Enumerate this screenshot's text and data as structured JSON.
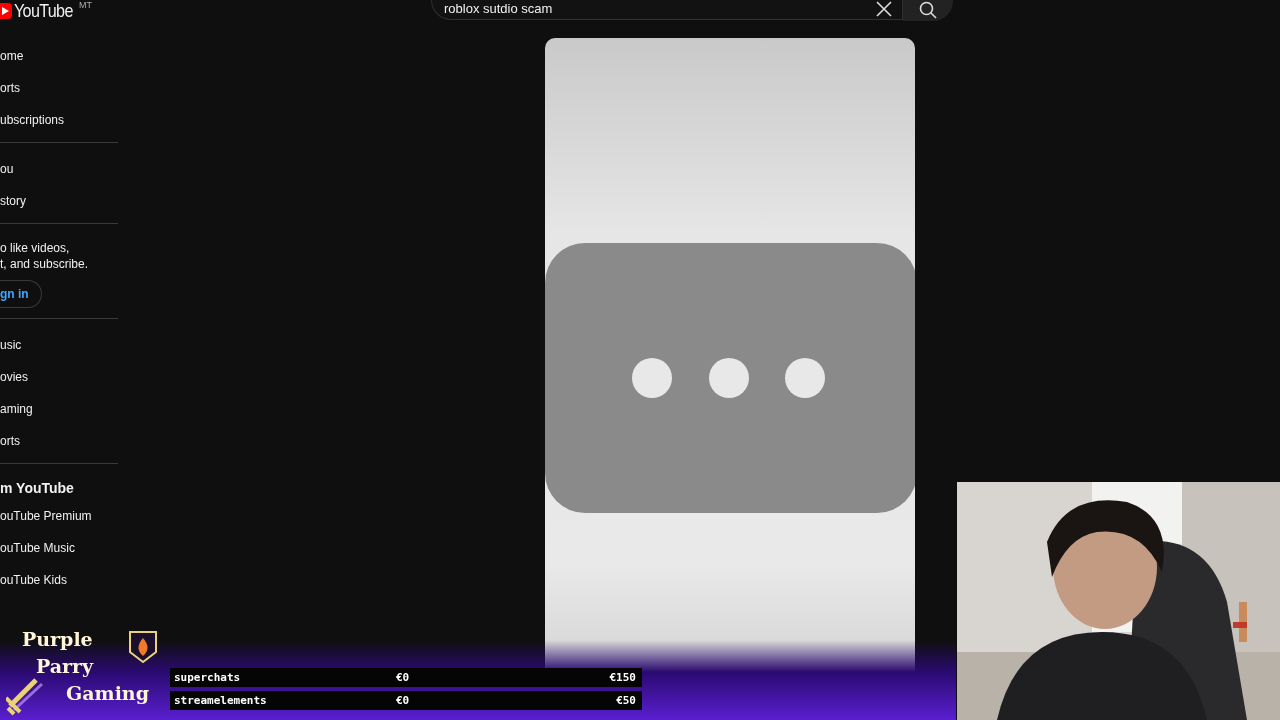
{
  "logo": {
    "text": "YouTube",
    "country": "MT"
  },
  "search": {
    "value": "roblox sutdio scam"
  },
  "sidebar": {
    "sections": [
      {
        "items": [
          {
            "label": "ome"
          },
          {
            "label": "orts"
          },
          {
            "label": "ubscriptions"
          }
        ]
      },
      {
        "items": [
          {
            "label": "ou"
          },
          {
            "label": "story"
          }
        ]
      },
      {
        "kind": "signin",
        "text": "o like videos,\nt, and subscribe.",
        "button": "gn in"
      },
      {
        "items": [
          {
            "label": "usic"
          },
          {
            "label": "ovies"
          },
          {
            "label": "aming"
          },
          {
            "label": "orts"
          }
        ]
      },
      {
        "heading": "m YouTube",
        "items": [
          {
            "label": "ouTube Premium"
          },
          {
            "label": "ouTube Music"
          },
          {
            "label": "ouTube Kids"
          }
        ]
      }
    ]
  },
  "video": {
    "kind": "picture"
  },
  "overlay": {
    "channel_logo": [
      "Purple",
      "Parry",
      "Gaming"
    ],
    "goals": [
      {
        "name": "superchats",
        "current": "€0",
        "target": "€150",
        "level": 0
      },
      {
        "name": "streamelements",
        "current": "€0",
        "target": "€50",
        "level": 0
      }
    ],
    "webcam": {
      "kind": "picture"
    }
  }
}
